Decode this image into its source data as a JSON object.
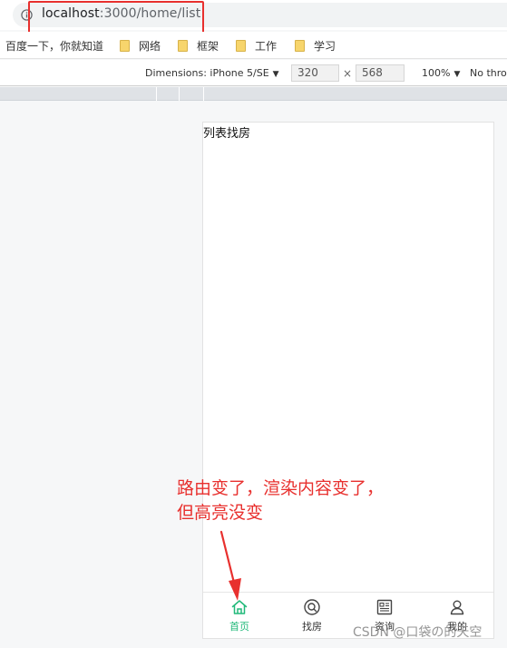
{
  "browser": {
    "url_host": "localhost",
    "url_port": ":3000",
    "url_path": "/home/list"
  },
  "bookmarks": [
    {
      "label": "百度一下，你就知道",
      "folder": false
    },
    {
      "label": "网络",
      "folder": true
    },
    {
      "label": "框架",
      "folder": true
    },
    {
      "label": "工作",
      "folder": true
    },
    {
      "label": "学习",
      "folder": true
    }
  ],
  "device_toolbar": {
    "device_label": "Dimensions: iPhone 5/SE",
    "width_value": "320",
    "height_value": "568",
    "times": "×",
    "zoom": "100%",
    "throttle": "No thro"
  },
  "page": {
    "content_text": "列表找房",
    "tabs": [
      {
        "label": "首页",
        "icon": "home-icon",
        "active": true
      },
      {
        "label": "找房",
        "icon": "search-icon",
        "active": false
      },
      {
        "label": "资询",
        "icon": "news-icon",
        "active": false
      },
      {
        "label": "我的",
        "icon": "user-icon",
        "active": false
      }
    ],
    "active_color": "#21b97a"
  },
  "annotation": {
    "line1": "路由变了，渲染内容变了，",
    "line2": "但高亮没变",
    "color": "#e8302e"
  },
  "watermark": "CSDN @口袋の的天空"
}
